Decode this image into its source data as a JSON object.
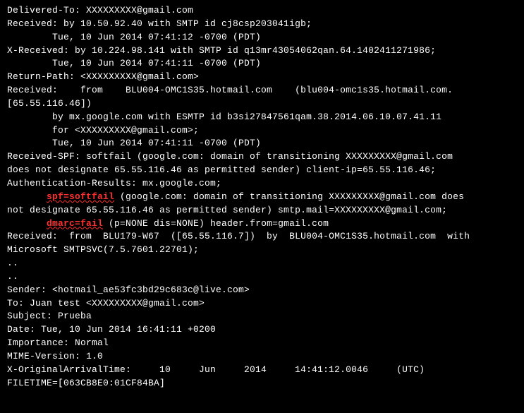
{
  "lines": [
    "Delivered-To: XXXXXXXXX@gmail.com",
    "Received: by 10.50.92.40 with SMTP id cj8csp203041igb;",
    "        Tue, 10 Jun 2014 07:41:12 -0700 (PDT)",
    "X-Received: by 10.224.98.141 with SMTP id q13mr43054062qan.64.1402411271986;",
    "        Tue, 10 Jun 2014 07:41:11 -0700 (PDT)",
    "Return-Path: <XXXXXXXXX@gmail.com>",
    "Received:    from    BLU004-OMC1S35.hotmail.com    (blu004-omc1s35.hotmail.com.",
    "[65.55.116.46])",
    "        by mx.google.com with ESMTP id b3si27847561qam.38.2014.06.10.07.41.11",
    "        for <XXXXXXXXX@gmail.com>;",
    "        Tue, 10 Jun 2014 07:41:11 -0700 (PDT)",
    "Received-SPF: softfail (google.com: domain of transitioning XXXXXXXXX@gmail.com",
    "does not designate 65.55.116.46 as permitted sender) client-ip=65.55.116.46;",
    "Authentication-Results: mx.google.com;"
  ],
  "hl1_prefix": "       ",
  "hl1_key": "spf=softfail",
  "hl1_rest1": " (google.com: domain of transitioning XXXXXXXXX@gmail.com does",
  "hl1_cont": "not designate 65.55.116.46 as permitted sender) smtp.mail=XXXXXXXXX@gmail.com;",
  "hl2_prefix": "       ",
  "hl2_key": "dmarc=fail",
  "hl2_rest": " (p=NONE dis=NONE) header.from=gmail.com",
  "lines2": [
    "Received:  from  BLU179-W67  ([65.55.116.7])  by  BLU004-OMC1S35.hotmail.com  with",
    "Microsoft SMTPSVC(7.5.7601.22701);",
    "",
    "..",
    "..",
    "",
    "",
    "Sender: <hotmail_ae53fc3bd29c683c@live.com>",
    "To: Juan test <XXXXXXXXX@gmail.com>",
    "Subject: Prueba",
    "Date: Tue, 10 Jun 2014 16:41:11 +0200",
    "Importance: Normal",
    "MIME-Version: 1.0",
    "X-OriginalArrivalTime:     10     Jun     2014     14:41:12.0046     (UTC)",
    "FILETIME=[063CB8E0:01CF84BA]"
  ]
}
